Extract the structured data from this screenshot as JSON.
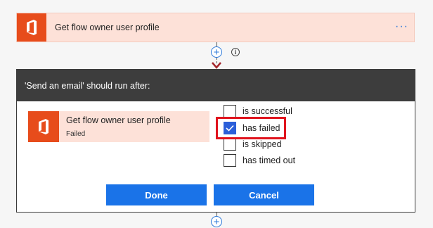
{
  "top_action": {
    "title": "Get flow owner user profile",
    "more_glyph": "···",
    "icon": "office-icon"
  },
  "connector": {
    "add_glyph": "+",
    "info_glyph": "i"
  },
  "dialog": {
    "title": "'Send an email' should run after:",
    "step": {
      "title": "Get flow owner user profile",
      "status": "Failed",
      "icon": "office-icon"
    },
    "options": [
      {
        "label": "is successful",
        "checked": false
      },
      {
        "label": "has failed",
        "checked": true
      },
      {
        "label": "is skipped",
        "checked": false
      },
      {
        "label": "has timed out",
        "checked": false
      }
    ],
    "done_label": "Done",
    "cancel_label": "Cancel"
  },
  "colors": {
    "office_orange": "#e74c1b",
    "card_bg": "#fde1d8",
    "accent_blue": "#1a73e8",
    "highlight_red": "#e0141e"
  }
}
